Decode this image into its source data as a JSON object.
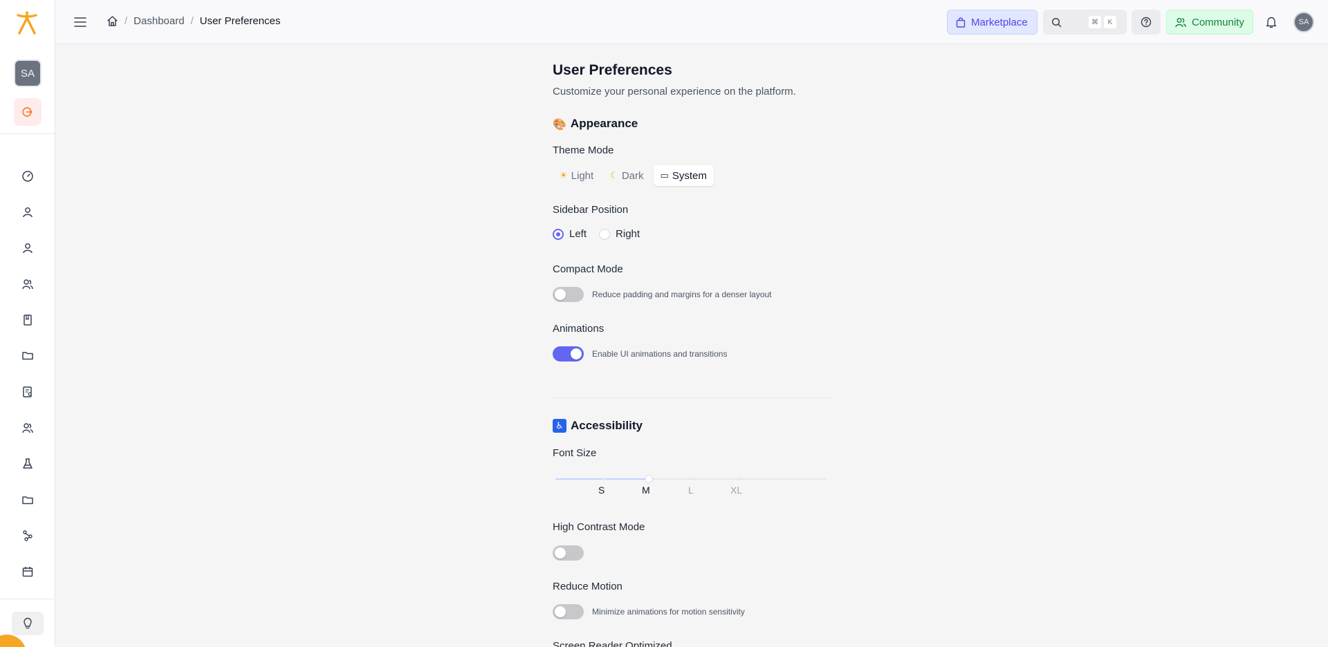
{
  "sidebar": {
    "avatar_initials": "SA",
    "nav": [
      {
        "icon": "gauge-icon"
      },
      {
        "icon": "user-icon"
      },
      {
        "icon": "user-icon"
      },
      {
        "icon": "users-icon"
      },
      {
        "icon": "book-icon"
      },
      {
        "icon": "folder-icon"
      },
      {
        "icon": "file-search-icon"
      },
      {
        "icon": "users-icon"
      },
      {
        "icon": "flask-icon"
      },
      {
        "icon": "folder-icon"
      },
      {
        "icon": "workflow-icon"
      },
      {
        "icon": "calendar-icon"
      }
    ]
  },
  "header": {
    "breadcrumb": {
      "home_icon": "home-icon",
      "parent": "Dashboard",
      "current": "User Preferences"
    },
    "marketplace_label": "Marketplace",
    "search_kbd": [
      "⌘",
      "K"
    ],
    "community_label": "Community",
    "avatar_initials": "SA"
  },
  "page": {
    "title": "User Preferences",
    "subtitle": "Customize your personal experience on the platform."
  },
  "appearance": {
    "title": "Appearance",
    "emoji": "🎨",
    "theme_label": "Theme Mode",
    "theme_options": [
      {
        "icon": "☀",
        "label": "Light"
      },
      {
        "icon": "☾",
        "label": "Dark"
      },
      {
        "icon": "▭",
        "label": "System"
      }
    ],
    "theme_selected": "System",
    "sidebar_label": "Sidebar Position",
    "sidebar_options": [
      "Left",
      "Right"
    ],
    "sidebar_selected": "Left",
    "compact_label": "Compact Mode",
    "compact_desc": "Reduce padding and margins for a denser layout",
    "compact_on": false,
    "animations_label": "Animations",
    "animations_desc": "Enable UI animations and transitions",
    "animations_on": true
  },
  "accessibility": {
    "title": "Accessibility",
    "emoji": "♿",
    "font_size_label": "Font Size",
    "font_sizes": [
      "S",
      "M",
      "L",
      "XL"
    ],
    "font_size_selected": "M",
    "high_contrast_label": "High Contrast Mode",
    "high_contrast_on": false,
    "reduce_motion_label": "Reduce Motion",
    "reduce_motion_desc": "Minimize animations for motion sensitivity",
    "reduce_motion_on": false,
    "screen_reader_label": "Screen Reader Optimized"
  },
  "colors": {
    "accent": "#6366f1",
    "brand": "#f5a623",
    "community": "#15803d"
  }
}
